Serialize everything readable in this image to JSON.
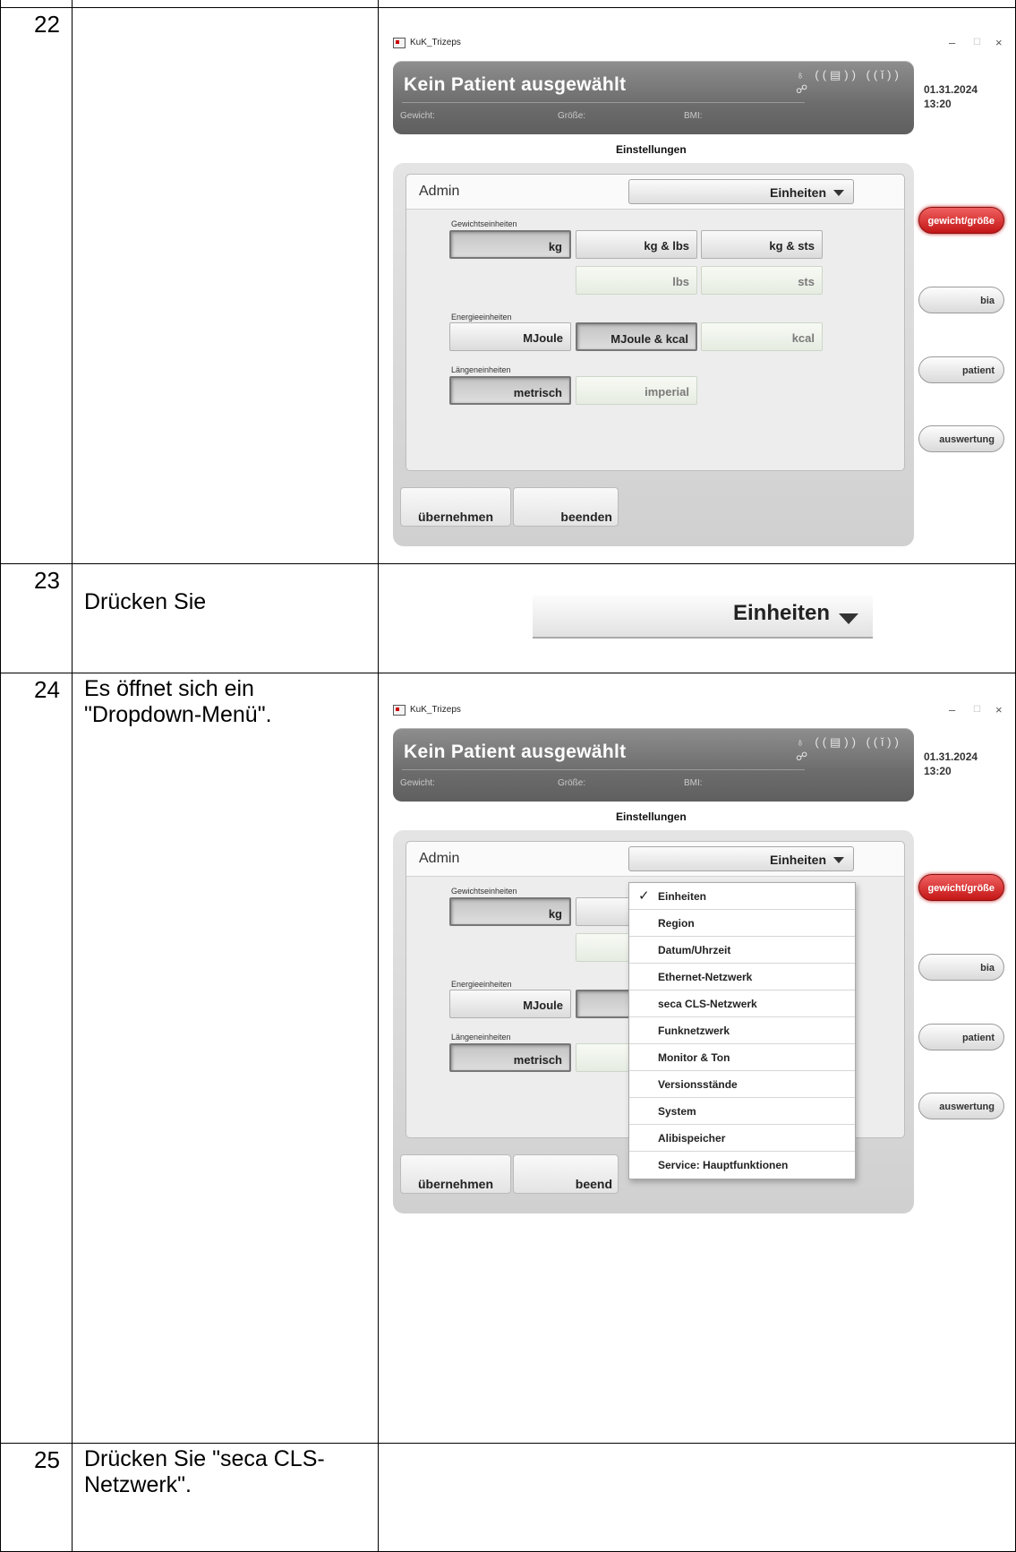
{
  "rows": [
    {
      "num": "22",
      "text": ""
    },
    {
      "num": "23",
      "text": "Drücken Sie"
    },
    {
      "num": "24",
      "text": "Es öffnet sich ein \"Dropdown-Menü\"."
    },
    {
      "num": "25",
      "text": "Drücken Sie \"seca CLS-Netzwerk\"."
    }
  ],
  "app": {
    "window_title": "KuK_Trizeps",
    "controls": {
      "minimize": "–",
      "maximize": "☐",
      "close": "×"
    },
    "patient": "Kein Patient ausgewählt",
    "weight_label": "Gewicht:",
    "height_label": "Größe:",
    "bmi_label": "BMI:",
    "status_icons": "♁ ((▤)) ((ǐ)) ☍",
    "date": "01.31.2024",
    "time": "13:20",
    "section": "Einstellungen",
    "admin": "Admin",
    "dropdown_label": "Einheiten",
    "weight_units_label": "Gewichtseinheiten",
    "energy_units_label": "Energieeinheiten",
    "length_units_label": "Längeneinheiten",
    "weight_buttons": [
      "kg",
      "kg & lbs",
      "kg & sts"
    ],
    "weight_buttons_row2": [
      "lbs",
      "sts"
    ],
    "energy_buttons": [
      "MJoule",
      "MJoule & kcal",
      "kcal"
    ],
    "length_buttons": [
      "metrisch",
      "imperial"
    ],
    "apply": "übernehmen",
    "exit": "beenden",
    "exit_truncated": "beend",
    "side_tabs": [
      "gewicht/größe",
      "bia",
      "patient",
      "auswertung"
    ],
    "accent": "#c41616"
  },
  "menu_items": [
    "Einheiten",
    "Region",
    "Datum/Uhrzeit",
    "Ethernet-Netzwerk",
    "seca CLS-Netzwerk",
    "Funknetzwerk",
    "Monitor & Ton",
    "Versionsstände",
    "System",
    "Alibispeicher",
    "Service: Hauptfunktionen"
  ],
  "menu_check": "✓"
}
